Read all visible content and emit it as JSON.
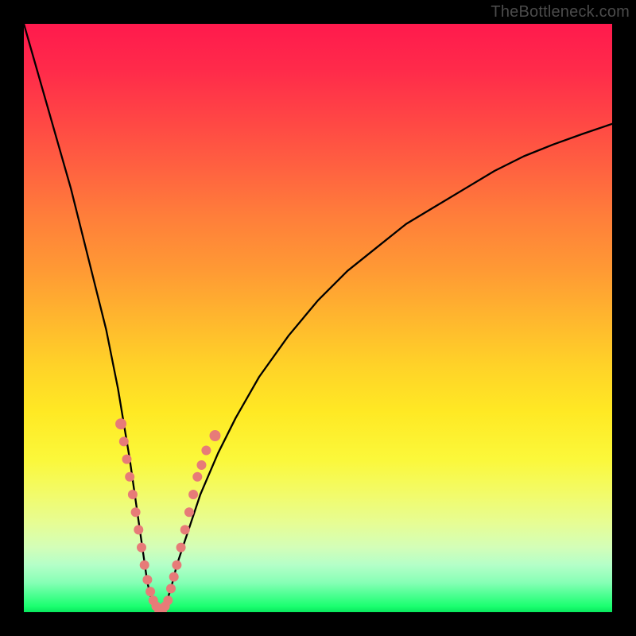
{
  "watermark": "TheBottleneck.com",
  "colors": {
    "curve": "#000000",
    "marker": "#e77b78",
    "marker_punch": "#e77b78"
  },
  "chart_data": {
    "type": "line",
    "title": "",
    "xlabel": "",
    "ylabel": "",
    "xlim": [
      0,
      100
    ],
    "ylim": [
      0,
      100
    ],
    "grid": false,
    "legend": false,
    "series": [
      {
        "name": "bottleneck-curve",
        "x": [
          0,
          2,
          4,
          6,
          8,
          10,
          12,
          14,
          16,
          18,
          19,
          20,
          21,
          22,
          23,
          24,
          25,
          26,
          28,
          30,
          33,
          36,
          40,
          45,
          50,
          55,
          60,
          65,
          70,
          75,
          80,
          85,
          90,
          95,
          100
        ],
        "y": [
          100,
          93,
          86,
          79,
          72,
          64,
          56,
          48,
          38,
          26,
          19,
          12,
          5,
          1,
          0,
          1,
          4,
          8,
          14,
          20,
          27,
          33,
          40,
          47,
          53,
          58,
          62,
          66,
          69,
          72,
          75,
          77.5,
          79.5,
          81.3,
          83
        ]
      }
    ],
    "markers": [
      {
        "x": 16.5,
        "y": 32,
        "kind": "punch"
      },
      {
        "x": 17.0,
        "y": 29,
        "kind": "dot"
      },
      {
        "x": 17.5,
        "y": 26,
        "kind": "dot"
      },
      {
        "x": 18.0,
        "y": 23,
        "kind": "dot"
      },
      {
        "x": 18.5,
        "y": 20,
        "kind": "dot"
      },
      {
        "x": 19.0,
        "y": 17,
        "kind": "dot"
      },
      {
        "x": 19.5,
        "y": 14,
        "kind": "dot"
      },
      {
        "x": 20.0,
        "y": 11,
        "kind": "dot"
      },
      {
        "x": 20.5,
        "y": 8,
        "kind": "dot"
      },
      {
        "x": 21.0,
        "y": 5.5,
        "kind": "dot"
      },
      {
        "x": 21.5,
        "y": 3.5,
        "kind": "dot"
      },
      {
        "x": 22.0,
        "y": 2,
        "kind": "dot"
      },
      {
        "x": 22.5,
        "y": 1,
        "kind": "dot"
      },
      {
        "x": 23.0,
        "y": 0,
        "kind": "dot"
      },
      {
        "x": 23.5,
        "y": 0,
        "kind": "dot"
      },
      {
        "x": 24.0,
        "y": 1,
        "kind": "dot"
      },
      {
        "x": 24.5,
        "y": 2,
        "kind": "dot"
      },
      {
        "x": 25.0,
        "y": 4,
        "kind": "dot"
      },
      {
        "x": 25.5,
        "y": 6,
        "kind": "dot"
      },
      {
        "x": 26.0,
        "y": 8,
        "kind": "dot"
      },
      {
        "x": 26.7,
        "y": 11,
        "kind": "dot"
      },
      {
        "x": 27.4,
        "y": 14,
        "kind": "dot"
      },
      {
        "x": 28.1,
        "y": 17,
        "kind": "dot"
      },
      {
        "x": 28.8,
        "y": 20,
        "kind": "dot"
      },
      {
        "x": 29.5,
        "y": 23,
        "kind": "dot"
      },
      {
        "x": 30.2,
        "y": 25,
        "kind": "dot"
      },
      {
        "x": 31.0,
        "y": 27.5,
        "kind": "dot"
      },
      {
        "x": 32.5,
        "y": 30,
        "kind": "punch"
      }
    ]
  }
}
